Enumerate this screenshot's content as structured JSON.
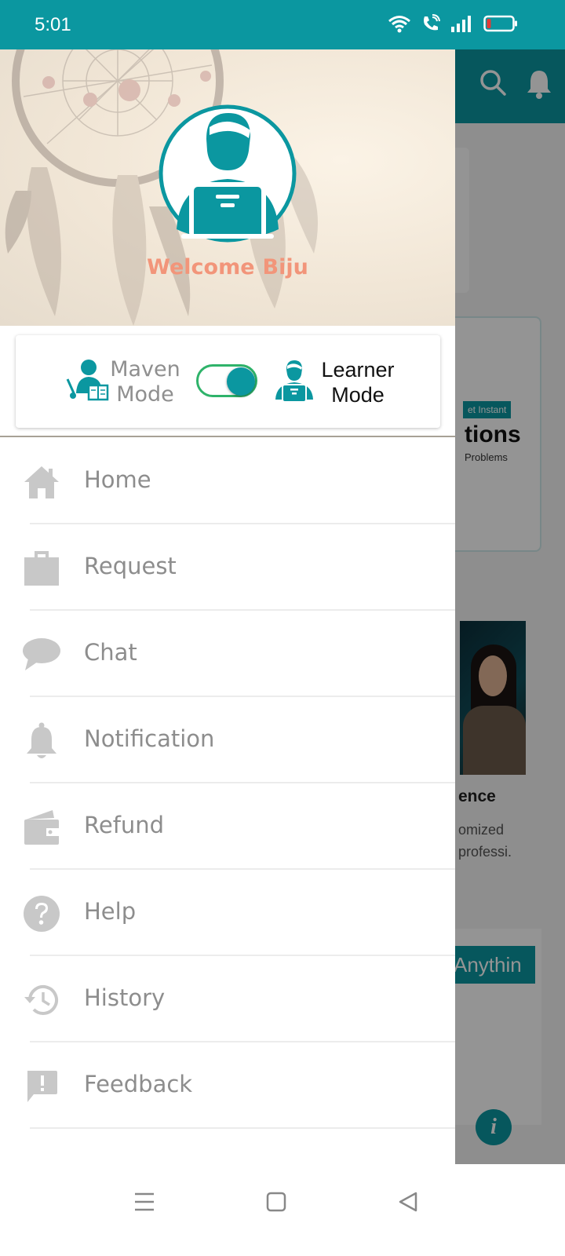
{
  "status_bar": {
    "time": "5:01",
    "battery_level": 0.15,
    "icons": [
      "wifi-icon",
      "wifi-call-icon",
      "signal-icon",
      "battery-icon"
    ]
  },
  "background_app": {
    "banner_tag": "et Instant",
    "banner_title": "tions",
    "banner_subtitle": "Problems",
    "card_title": "ence",
    "card_desc_line1": "omized",
    "card_desc_line2": "professi.",
    "cta_label": "Anythin",
    "info_glyph": "i"
  },
  "drawer": {
    "welcome_word": "Welcome",
    "user_name": "Biju",
    "mode_switch": {
      "left_label_line1": "Maven",
      "left_label_line2": "Mode",
      "right_label_line1": "Learner",
      "right_label_line2": "Mode",
      "active": "learner"
    },
    "menu": [
      {
        "label": "Home",
        "icon": "home-icon"
      },
      {
        "label": "Request",
        "icon": "briefcase-icon"
      },
      {
        "label": "Chat",
        "icon": "chat-bubble-icon"
      },
      {
        "label": "Notification",
        "icon": "bell-icon"
      },
      {
        "label": "Refund",
        "icon": "wallet-icon"
      },
      {
        "label": "Help",
        "icon": "help-circle-icon"
      },
      {
        "label": "History",
        "icon": "history-icon"
      },
      {
        "label": "Feedback",
        "icon": "feedback-icon"
      }
    ]
  },
  "colors": {
    "brand_teal": "#0b97a0",
    "welcome_orange": "#f2957a",
    "menu_grey": "#8d8d8d",
    "icon_grey": "#c8c8c8",
    "toggle_green": "#2fb36a"
  }
}
